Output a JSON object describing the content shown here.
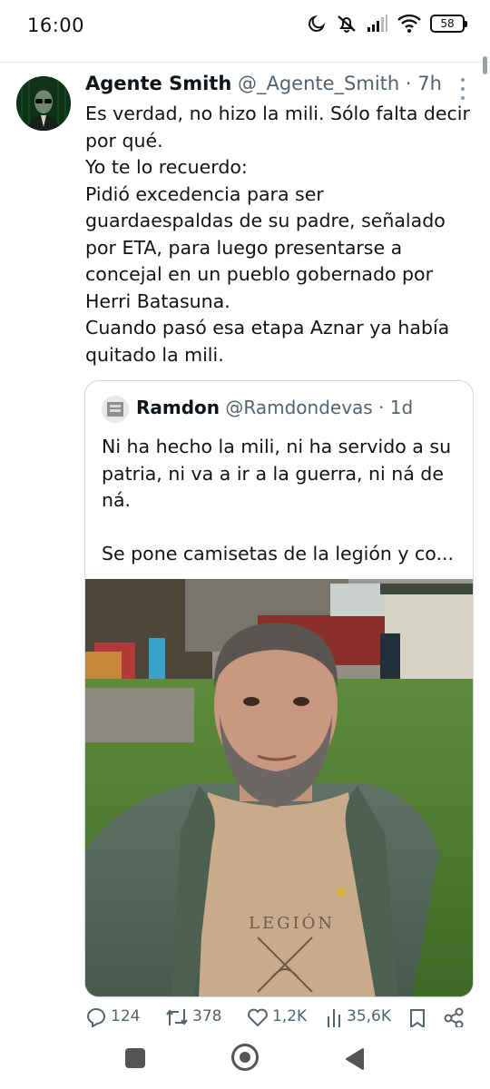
{
  "status_bar": {
    "time": "16:00",
    "battery": "58",
    "icons": [
      "moon-icon",
      "mute-icon",
      "signal-icon",
      "wifi-icon",
      "battery-icon"
    ]
  },
  "tweet": {
    "author_name": "Agente Smith",
    "author_handle": "@_Agente_Smith",
    "separator": "·",
    "time_ago": "7h",
    "text_lines": [
      "Es verdad, no hizo la mili. Sólo falta decir",
      "por qué.",
      "Yo te lo recuerdo:",
      "Pidió excedencia para ser",
      "guardaespaldas de su padre, señalado",
      "por ETA, para luego presentarse a",
      "concejal en un pueblo gobernado por",
      "Herri Batasuna.",
      "Cuando pasó esa etapa Aznar ya había",
      "quitado la mili."
    ]
  },
  "quote": {
    "author_name": "Ramdon",
    "author_handle": "@Ramdondevas",
    "separator": "·",
    "time_ago": "1d",
    "text_lines": [
      "Ni ha hecho la mili, ni ha servido a su",
      "patria, ni va a ir a la guerra, ni ná de",
      "ná.",
      "",
      "Se pone camisetas de la legión y co..."
    ],
    "image_text": "LEGIÓN"
  },
  "actions": {
    "replies": "124",
    "retweets": "378",
    "likes": "1,2K",
    "views": "35,6K"
  },
  "colors": {
    "text": "#0f1419",
    "secondary": "#536471",
    "border": "#cfd9de"
  }
}
